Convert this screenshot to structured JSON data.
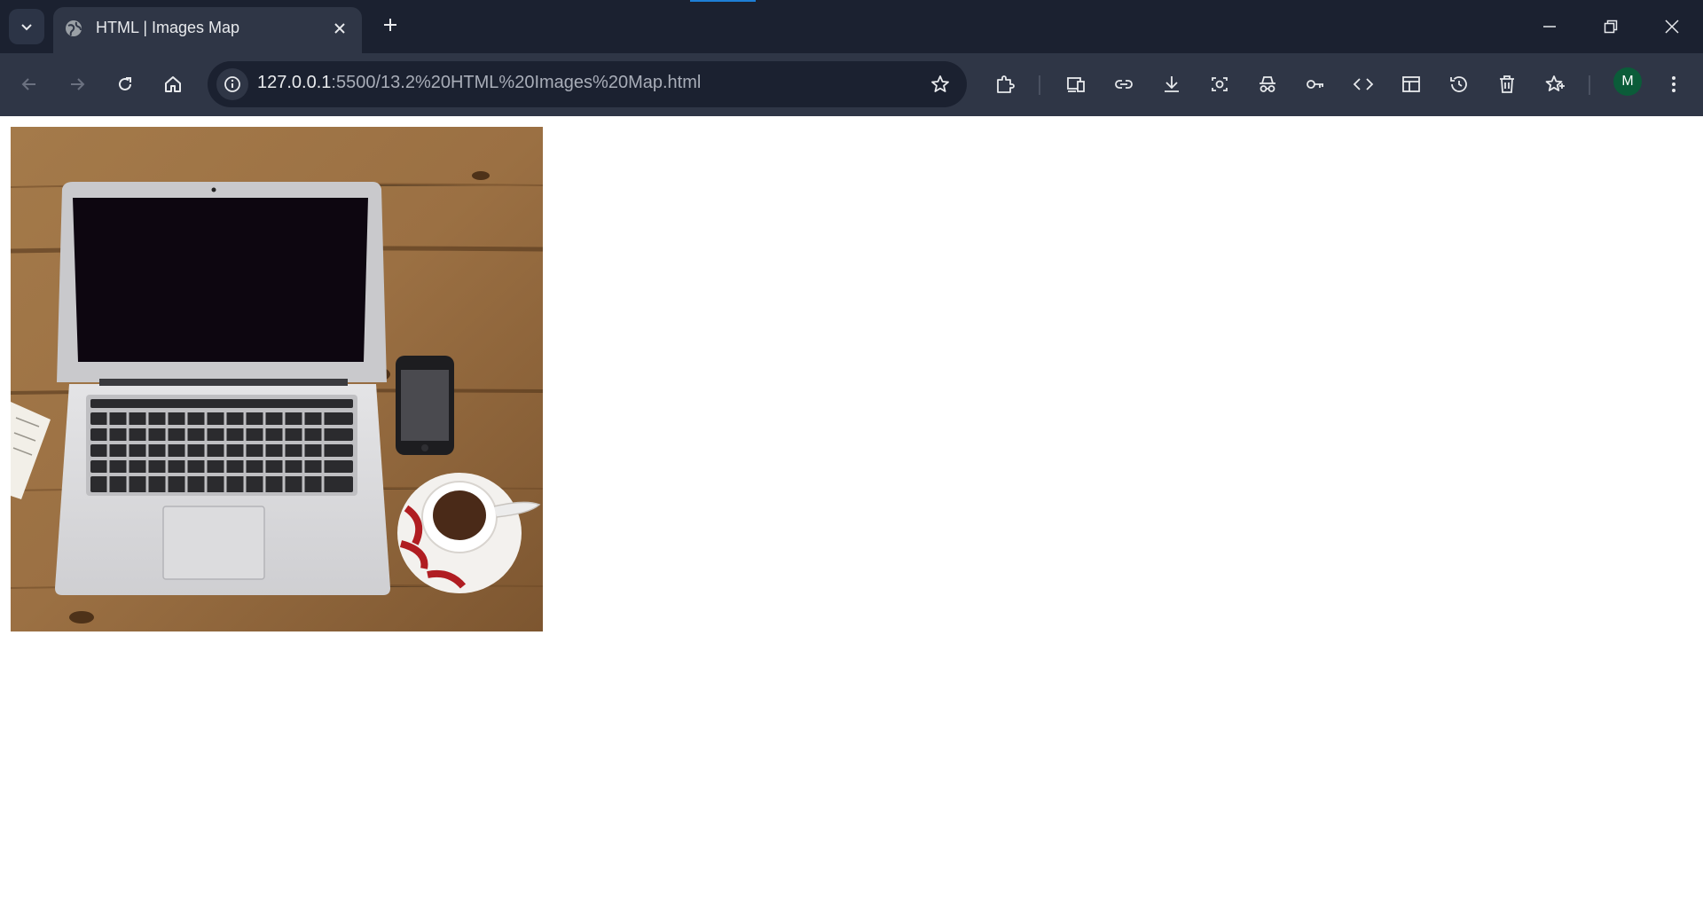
{
  "browser": {
    "tab": {
      "title": "HTML | Images Map",
      "favicon": "globe-icon"
    },
    "address_bar": {
      "host": "127.0.0.1",
      "rest": ":5500/13.2%20HTML%20Images%20Map.html"
    },
    "profile_initial": "M",
    "toolbar_icons": [
      "extensions-icon",
      "device-toolbar-icon",
      "link-icon",
      "download-icon",
      "screenshot-icon",
      "incognito-icon",
      "password-key-icon",
      "code-icon",
      "layout-icon",
      "history-icon",
      "trash-icon",
      "favorites-icon"
    ],
    "colors": {
      "tabbar": "#1b2130",
      "toolbar": "#2f3646",
      "accent": "#1e7fd6",
      "avatar": "#0b5c39"
    }
  },
  "page": {
    "image_alt": "Laptop, phone and coffee cup on a wooden desk"
  }
}
